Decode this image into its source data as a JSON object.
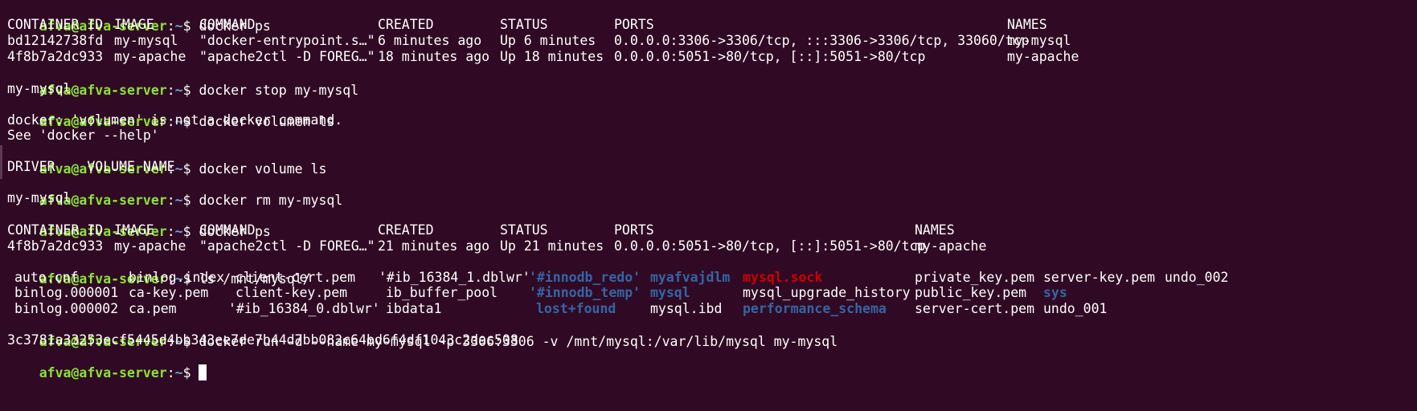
{
  "prompt": {
    "user_host": "afva@afva-server",
    "colon": ":",
    "path": "~",
    "dollar": "$ "
  },
  "commands": {
    "c1": "docker ps",
    "c2": "docker stop my-mysql",
    "c3": "docker volumen ls",
    "c4": "docker volume ls",
    "c5": "docker rm my-mysql",
    "c6": "docker ps",
    "c7": "ls /mnt/mysql/",
    "c8": "docker run -d --name my-mysql -p 3306:3306 -v /mnt/mysql:/var/lib/mysql my-mysql"
  },
  "ps1": {
    "headers": [
      "CONTAINER ID",
      "IMAGE",
      "COMMAND",
      "CREATED",
      "STATUS",
      "PORTS",
      "NAMES"
    ],
    "rows": [
      [
        "bd12142738fd",
        "my-mysql",
        "\"docker-entrypoint.s…\"",
        "6 minutes ago",
        "Up 6 minutes",
        "0.0.0.0:3306->3306/tcp, :::3306->3306/tcp, 33060/tcp",
        "my-mysql"
      ],
      [
        "4f8b7a2dc933",
        "my-apache",
        "\"apache2ctl -D FOREG…\"",
        "18 minutes ago",
        "Up 18 minutes",
        "0.0.0.0:5051->80/tcp, [::]:5051->80/tcp",
        "my-apache"
      ]
    ]
  },
  "outputs": {
    "stop": "my-mysql",
    "volumen_error_1": "docker: 'volumen' is not a docker command.",
    "volumen_error_2": "See 'docker --help'",
    "volume_header": "DRIVER    VOLUME NAME",
    "rm": "my-mysql",
    "run_id": "3c3781a33253ecf5445d4bb343ee7de7b44d7bb082c64bd6f4df1043c2dac508"
  },
  "ps2": {
    "headers": [
      "CONTAINER ID",
      "IMAGE",
      "COMMAND",
      "CREATED",
      "STATUS",
      "PORTS",
      "NAMES"
    ],
    "rows": [
      [
        "4f8b7a2dc933",
        "my-apache",
        "\"apache2ctl -D FOREG…\"",
        "21 minutes ago",
        "Up 21 minutes",
        "0.0.0.0:5051->80/tcp, [::]:5051->80/tcp",
        "my-apache"
      ]
    ]
  },
  "ls": {
    "r1": [
      "auto.cnf",
      "binlog.index",
      "client-cert.pem",
      "'#ib_16384_1.dblwr'",
      "'#innodb_redo'",
      "myafvajdlm",
      "mysql.sock",
      "private_key.pem",
      "server-key.pem",
      "undo_002"
    ],
    "r2": [
      "binlog.000001",
      "ca-key.pem",
      "client-key.pem",
      "ib_buffer_pool",
      "'#innodb_temp'",
      "mysql",
      "mysql_upgrade_history",
      "public_key.pem",
      "sys"
    ],
    "r3": [
      "binlog.000002",
      "ca.pem",
      "'#ib_16384_0.dblwr'",
      "ibdata1",
      "lost+found",
      "mysql.ibd",
      "performance_schema",
      "server-cert.pem",
      "undo_001"
    ]
  },
  "colors": {
    "background": "#300a24",
    "prompt_user": "#8ae234",
    "prompt_path": "#729fcf",
    "directory": "#3465a4",
    "socket": "#cc0000",
    "text": "#ffffff"
  }
}
